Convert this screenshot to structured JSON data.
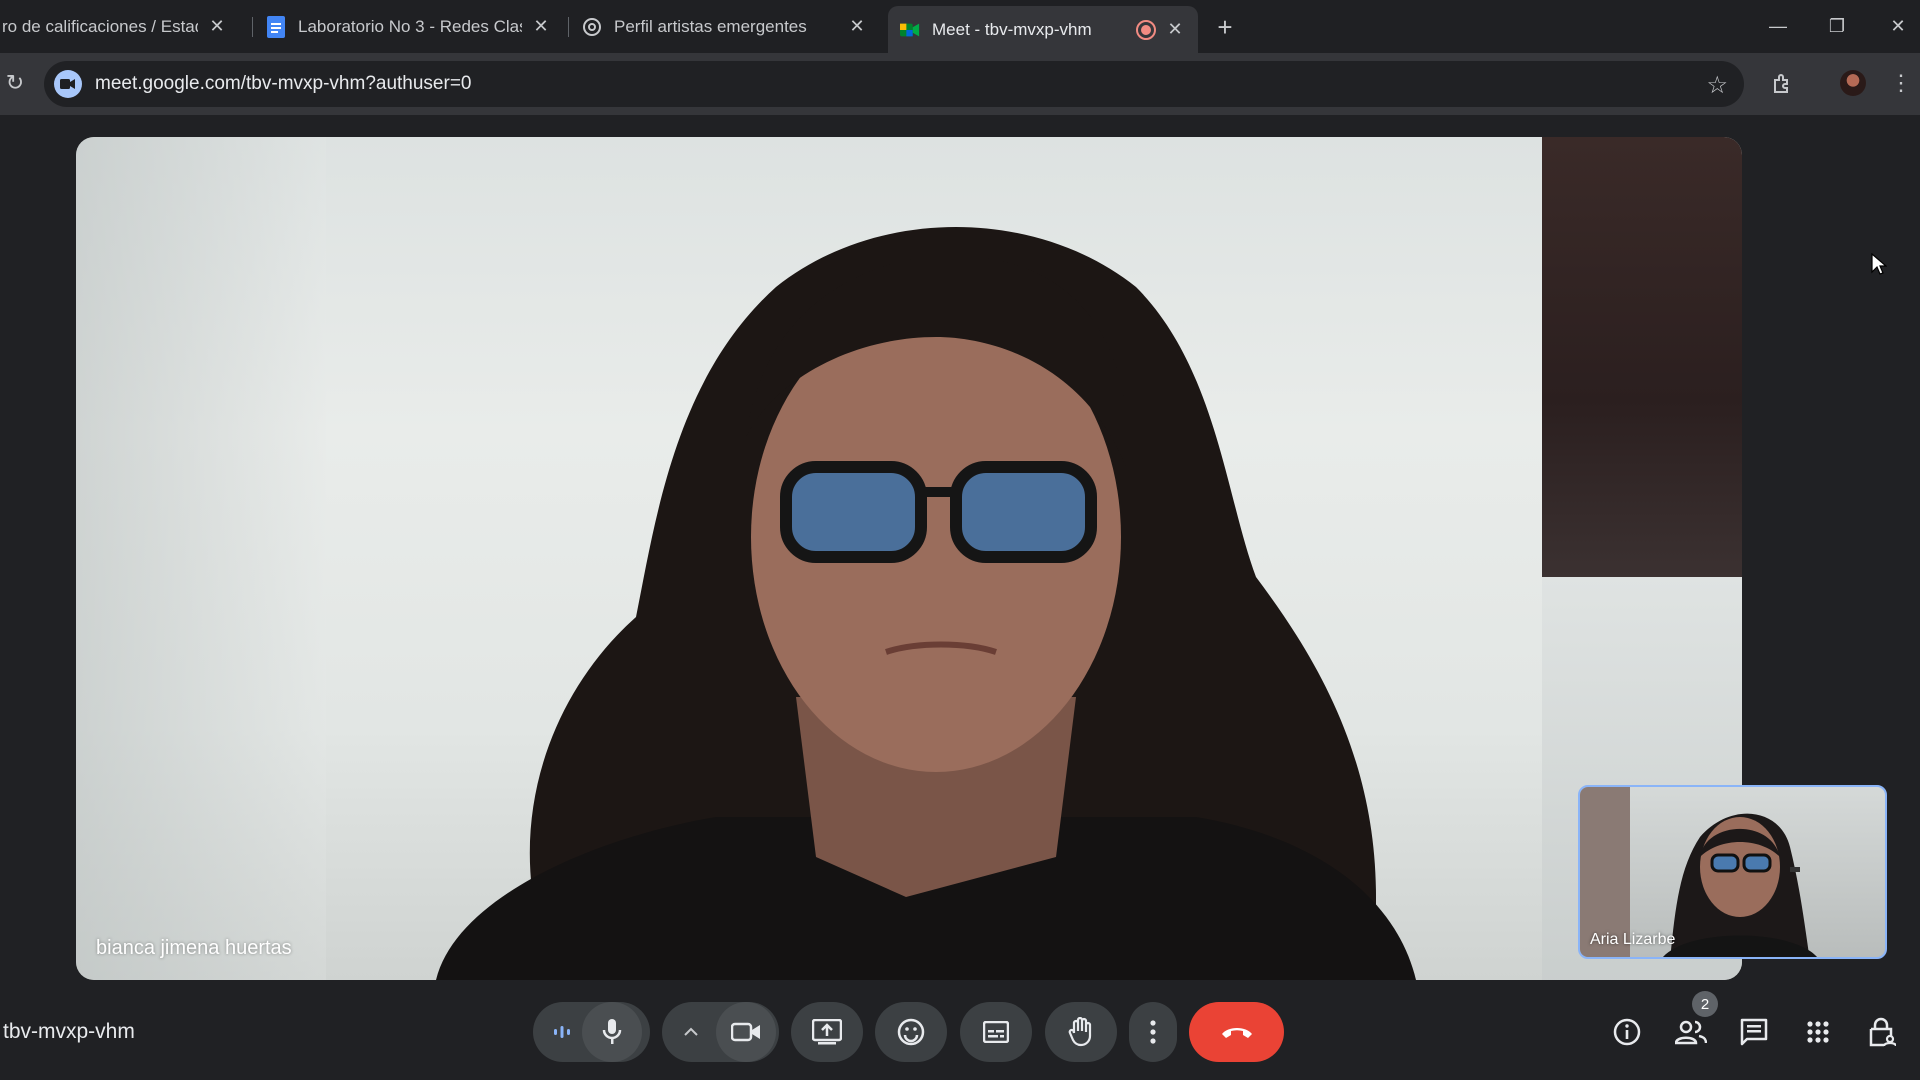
{
  "browser": {
    "tabs": [
      {
        "label": "ro de calificaciones / Estadís",
        "icon": "gradebook-icon",
        "active": false
      },
      {
        "label": "Laboratorio No 3 - Redes Clasif",
        "icon": "docs-icon",
        "active": false
      },
      {
        "label": "Perfil artistas emergentes",
        "icon": "openai-icon",
        "active": false
      },
      {
        "label": "Meet - tbv-mvxp-vhm",
        "icon": "meet-icon",
        "active": true
      }
    ],
    "url": "meet.google.com/tbv-mvxp-vhm?authuser=0"
  },
  "meeting": {
    "code": "tbv-mvxp-vhm",
    "main_participant": "bianca jimena huertas",
    "pip_participant": "Aria Lizarbe",
    "participant_count": "2"
  },
  "colors": {
    "hangup": "#ea4335",
    "pip_border": "#8ab4f8",
    "background": "#202124"
  }
}
